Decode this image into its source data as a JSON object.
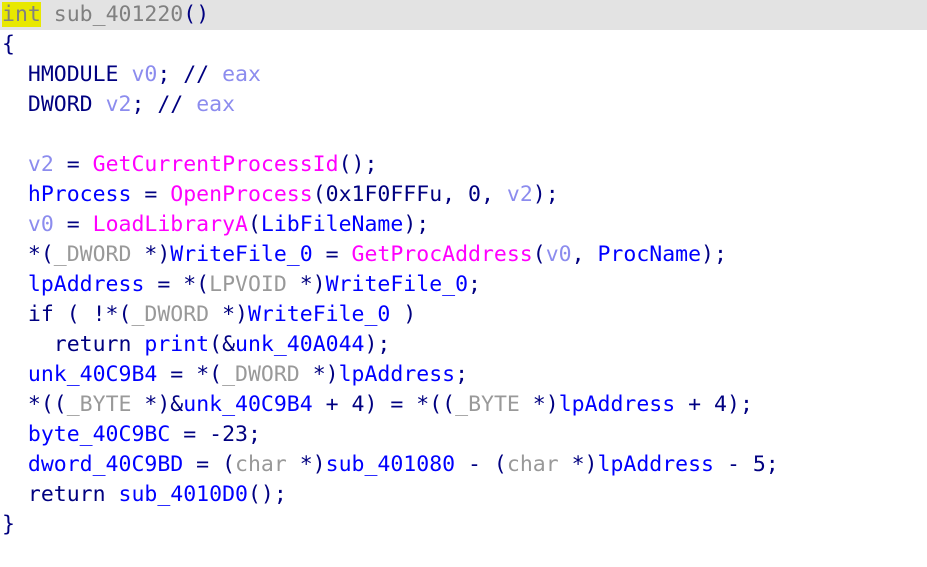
{
  "window": {
    "view_name": "pseudocode-decompiler",
    "current_line_bg": "#e3e3e3",
    "highlight_bg": "#e8e800"
  },
  "colors": {
    "global": "#0000ff",
    "local": "#8c8cee",
    "function": "#ff00ff",
    "cast_type": "#999999",
    "keyword": "#000080",
    "comment": "#8c8cee",
    "plain": "#808080",
    "background": "#ffffff"
  },
  "code": {
    "lines": [
      {
        "index": 0,
        "current": true,
        "tokens": [
          {
            "text": "int",
            "cls": "t-hl"
          },
          {
            "text": " ",
            "cls": "t-plain"
          },
          {
            "text": "sub_401220",
            "cls": "t-plain"
          },
          {
            "text": "()",
            "cls": "t-punc"
          }
        ]
      },
      {
        "index": 1,
        "current": false,
        "tokens": [
          {
            "text": "{",
            "cls": "t-punc"
          }
        ]
      },
      {
        "index": 2,
        "current": false,
        "tokens": [
          {
            "text": "  ",
            "cls": "t-plain"
          },
          {
            "text": "HMODULE",
            "cls": "t-type"
          },
          {
            "text": " ",
            "cls": "t-plain"
          },
          {
            "text": "v0",
            "cls": "t-loc"
          },
          {
            "text": "; ",
            "cls": "t-punc"
          },
          {
            "text": "// ",
            "cls": "t-punc"
          },
          {
            "text": "eax",
            "cls": "t-cmt"
          }
        ]
      },
      {
        "index": 3,
        "current": false,
        "tokens": [
          {
            "text": "  ",
            "cls": "t-plain"
          },
          {
            "text": "DWORD",
            "cls": "t-type"
          },
          {
            "text": " ",
            "cls": "t-plain"
          },
          {
            "text": "v2",
            "cls": "t-loc"
          },
          {
            "text": "; ",
            "cls": "t-punc"
          },
          {
            "text": "// ",
            "cls": "t-punc"
          },
          {
            "text": "eax",
            "cls": "t-cmt"
          }
        ]
      },
      {
        "index": 4,
        "current": false,
        "tokens": []
      },
      {
        "index": 5,
        "current": false,
        "tokens": [
          {
            "text": "  ",
            "cls": "t-plain"
          },
          {
            "text": "v2",
            "cls": "t-loc"
          },
          {
            "text": " = ",
            "cls": "t-op"
          },
          {
            "text": "GetCurrentProcessId",
            "cls": "t-func"
          },
          {
            "text": "();",
            "cls": "t-punc"
          }
        ]
      },
      {
        "index": 6,
        "current": false,
        "tokens": [
          {
            "text": "  ",
            "cls": "t-plain"
          },
          {
            "text": "hProcess",
            "cls": "t-glob"
          },
          {
            "text": " = ",
            "cls": "t-op"
          },
          {
            "text": "OpenProcess",
            "cls": "t-func"
          },
          {
            "text": "(",
            "cls": "t-punc"
          },
          {
            "text": "0x1F0FFFu",
            "cls": "t-num"
          },
          {
            "text": ", ",
            "cls": "t-punc"
          },
          {
            "text": "0",
            "cls": "t-num"
          },
          {
            "text": ", ",
            "cls": "t-punc"
          },
          {
            "text": "v2",
            "cls": "t-loc"
          },
          {
            "text": ");",
            "cls": "t-punc"
          }
        ]
      },
      {
        "index": 7,
        "current": false,
        "tokens": [
          {
            "text": "  ",
            "cls": "t-plain"
          },
          {
            "text": "v0",
            "cls": "t-loc"
          },
          {
            "text": " = ",
            "cls": "t-op"
          },
          {
            "text": "LoadLibraryA",
            "cls": "t-func"
          },
          {
            "text": "(",
            "cls": "t-punc"
          },
          {
            "text": "LibFileName",
            "cls": "t-glob"
          },
          {
            "text": ");",
            "cls": "t-punc"
          }
        ]
      },
      {
        "index": 8,
        "current": false,
        "tokens": [
          {
            "text": "  ",
            "cls": "t-plain"
          },
          {
            "text": "*(",
            "cls": "t-op"
          },
          {
            "text": "_DWORD",
            "cls": "t-cast"
          },
          {
            "text": " *)",
            "cls": "t-op"
          },
          {
            "text": "WriteFile_0",
            "cls": "t-glob"
          },
          {
            "text": " = ",
            "cls": "t-op"
          },
          {
            "text": "GetProcAddress",
            "cls": "t-func"
          },
          {
            "text": "(",
            "cls": "t-punc"
          },
          {
            "text": "v0",
            "cls": "t-loc"
          },
          {
            "text": ", ",
            "cls": "t-punc"
          },
          {
            "text": "ProcName",
            "cls": "t-glob"
          },
          {
            "text": ");",
            "cls": "t-punc"
          }
        ]
      },
      {
        "index": 9,
        "current": false,
        "tokens": [
          {
            "text": "  ",
            "cls": "t-plain"
          },
          {
            "text": "lpAddress",
            "cls": "t-glob"
          },
          {
            "text": " = ",
            "cls": "t-op"
          },
          {
            "text": "*(",
            "cls": "t-op"
          },
          {
            "text": "LPVOID",
            "cls": "t-cast"
          },
          {
            "text": " *)",
            "cls": "t-op"
          },
          {
            "text": "WriteFile_0",
            "cls": "t-glob"
          },
          {
            "text": ";",
            "cls": "t-punc"
          }
        ]
      },
      {
        "index": 10,
        "current": false,
        "tokens": [
          {
            "text": "  ",
            "cls": "t-plain"
          },
          {
            "text": "if",
            "cls": "t-kw"
          },
          {
            "text": " ( !*(",
            "cls": "t-op"
          },
          {
            "text": "_DWORD",
            "cls": "t-cast"
          },
          {
            "text": " *)",
            "cls": "t-op"
          },
          {
            "text": "WriteFile_0",
            "cls": "t-glob"
          },
          {
            "text": " )",
            "cls": "t-punc"
          }
        ]
      },
      {
        "index": 11,
        "current": false,
        "tokens": [
          {
            "text": "    ",
            "cls": "t-plain"
          },
          {
            "text": "return",
            "cls": "t-kw"
          },
          {
            "text": " ",
            "cls": "t-plain"
          },
          {
            "text": "print",
            "cls": "t-glob"
          },
          {
            "text": "(&",
            "cls": "t-punc"
          },
          {
            "text": "unk_40A044",
            "cls": "t-glob"
          },
          {
            "text": ");",
            "cls": "t-punc"
          }
        ]
      },
      {
        "index": 12,
        "current": false,
        "tokens": [
          {
            "text": "  ",
            "cls": "t-plain"
          },
          {
            "text": "unk_40C9B4",
            "cls": "t-glob"
          },
          {
            "text": " = ",
            "cls": "t-op"
          },
          {
            "text": "*(",
            "cls": "t-op"
          },
          {
            "text": "_DWORD",
            "cls": "t-cast"
          },
          {
            "text": " *)",
            "cls": "t-op"
          },
          {
            "text": "lpAddress",
            "cls": "t-glob"
          },
          {
            "text": ";",
            "cls": "t-punc"
          }
        ]
      },
      {
        "index": 13,
        "current": false,
        "tokens": [
          {
            "text": "  ",
            "cls": "t-plain"
          },
          {
            "text": "*((",
            "cls": "t-op"
          },
          {
            "text": "_BYTE",
            "cls": "t-cast"
          },
          {
            "text": " *)&",
            "cls": "t-op"
          },
          {
            "text": "unk_40C9B4",
            "cls": "t-glob"
          },
          {
            "text": " + ",
            "cls": "t-op"
          },
          {
            "text": "4",
            "cls": "t-num"
          },
          {
            "text": ") = ",
            "cls": "t-op"
          },
          {
            "text": "*((",
            "cls": "t-op"
          },
          {
            "text": "_BYTE",
            "cls": "t-cast"
          },
          {
            "text": " *)",
            "cls": "t-op"
          },
          {
            "text": "lpAddress",
            "cls": "t-glob"
          },
          {
            "text": " + ",
            "cls": "t-op"
          },
          {
            "text": "4",
            "cls": "t-num"
          },
          {
            "text": ");",
            "cls": "t-punc"
          }
        ]
      },
      {
        "index": 14,
        "current": false,
        "tokens": [
          {
            "text": "  ",
            "cls": "t-plain"
          },
          {
            "text": "byte_40C9BC",
            "cls": "t-glob"
          },
          {
            "text": " = ",
            "cls": "t-op"
          },
          {
            "text": "-23",
            "cls": "t-num"
          },
          {
            "text": ";",
            "cls": "t-punc"
          }
        ]
      },
      {
        "index": 15,
        "current": false,
        "tokens": [
          {
            "text": "  ",
            "cls": "t-plain"
          },
          {
            "text": "dword_40C9BD",
            "cls": "t-glob"
          },
          {
            "text": " = (",
            "cls": "t-op"
          },
          {
            "text": "char",
            "cls": "t-cast"
          },
          {
            "text": " *)",
            "cls": "t-op"
          },
          {
            "text": "sub_401080",
            "cls": "t-glob"
          },
          {
            "text": " - (",
            "cls": "t-op"
          },
          {
            "text": "char",
            "cls": "t-cast"
          },
          {
            "text": " *)",
            "cls": "t-op"
          },
          {
            "text": "lpAddress",
            "cls": "t-glob"
          },
          {
            "text": " - ",
            "cls": "t-op"
          },
          {
            "text": "5",
            "cls": "t-num"
          },
          {
            "text": ";",
            "cls": "t-punc"
          }
        ]
      },
      {
        "index": 16,
        "current": false,
        "tokens": [
          {
            "text": "  ",
            "cls": "t-plain"
          },
          {
            "text": "return",
            "cls": "t-kw"
          },
          {
            "text": " ",
            "cls": "t-plain"
          },
          {
            "text": "sub_4010D0",
            "cls": "t-glob"
          },
          {
            "text": "();",
            "cls": "t-punc"
          }
        ]
      },
      {
        "index": 17,
        "current": false,
        "tokens": [
          {
            "text": "}",
            "cls": "t-punc"
          }
        ]
      }
    ]
  }
}
